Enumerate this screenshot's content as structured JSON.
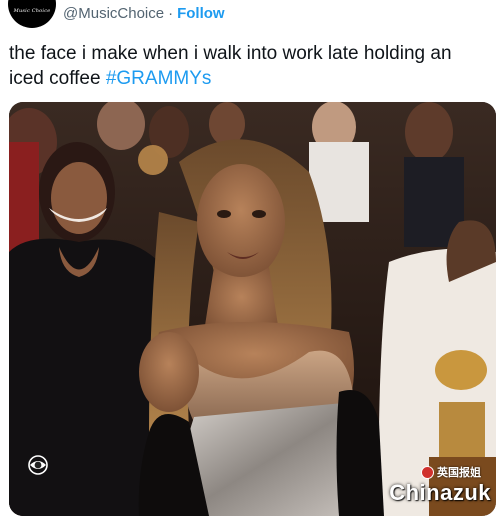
{
  "avatar": {
    "logo_text": "Music Choice"
  },
  "header": {
    "handle": "@MusicChoice",
    "separator": "·",
    "follow_label": "Follow"
  },
  "tweet": {
    "text": "the face i make when i walk into work late holding an iced coffee ",
    "hashtag": "#GRAMMYs"
  },
  "media": {
    "broadcaster_logo": "cbs-eye-icon"
  },
  "watermark": {
    "small_text": "英国报姐",
    "large_text": "Chinazuk"
  },
  "colors": {
    "link": "#1d9bf0",
    "text": "#0f1419",
    "secondary": "#536471"
  }
}
